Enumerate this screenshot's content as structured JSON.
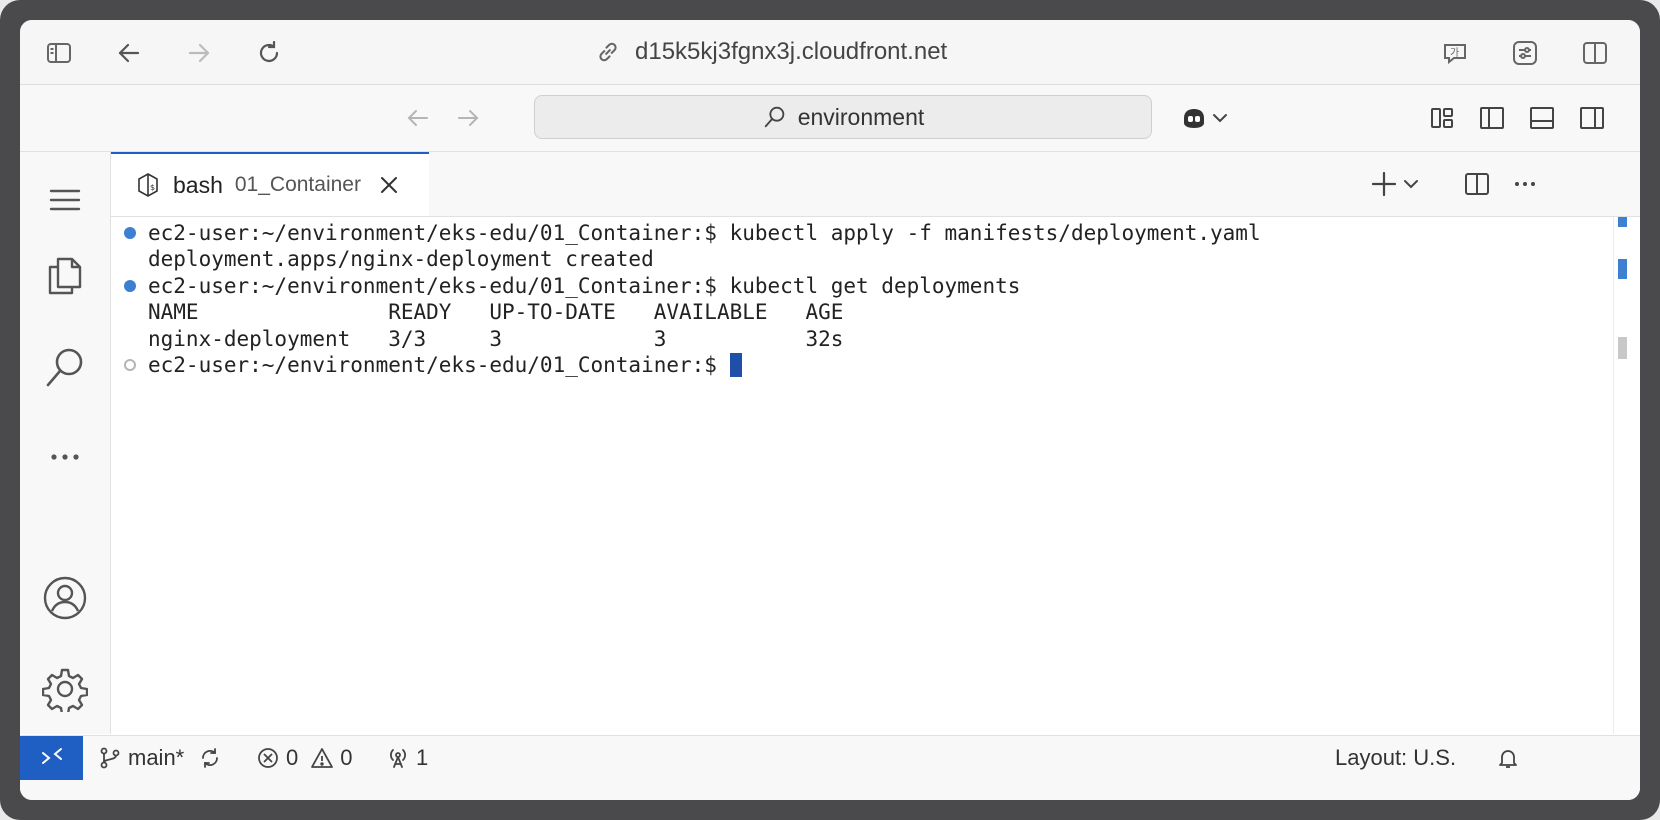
{
  "browser": {
    "url": "d15k5kj3fgnx3j.cloudfront.net",
    "icons": [
      "sidebar-icon",
      "back-icon",
      "forward-icon",
      "reload-icon",
      "link-icon",
      "translate-icon",
      "page-settings-icon",
      "split-view-icon"
    ]
  },
  "command_bar": {
    "search_text": "environment",
    "icons": [
      "back-arrow-icon",
      "forward-arrow-icon",
      "search-icon",
      "copilot-icon",
      "chevron-down-icon",
      "customize-layout-icon",
      "toggle-primary-sidebar-icon",
      "toggle-panel-icon",
      "toggle-secondary-sidebar-icon"
    ]
  },
  "activity_bar": {
    "items": [
      "menu-icon",
      "explorer-icon",
      "search-icon",
      "more-icon",
      "accounts-icon",
      "manage-gear-icon"
    ]
  },
  "tab": {
    "name": "bash",
    "description": "01_Container"
  },
  "terminal": {
    "lines": [
      {
        "decoration": "done",
        "text": "ec2-user:~/environment/eks-edu/01_Container:$ kubectl apply -f manifests/deployment.yaml"
      },
      {
        "decoration": "none",
        "text": "deployment.apps/nginx-deployment created"
      },
      {
        "decoration": "done",
        "text": "ec2-user:~/environment/eks-edu/01_Container:$ kubectl get deployments"
      },
      {
        "decoration": "none",
        "text": "NAME               READY   UP-TO-DATE   AVAILABLE   AGE"
      },
      {
        "decoration": "none",
        "text": "nginx-deployment   3/3     3            3           32s"
      },
      {
        "decoration": "pending",
        "text": "ec2-user:~/environment/eks-edu/01_Container:$ "
      }
    ]
  },
  "status_bar": {
    "branch": "main*",
    "errors": "0",
    "warnings": "0",
    "ports": "1",
    "layout": "Layout: U.S."
  },
  "colors": {
    "accent": "#1f5fc4",
    "terminal_decoration": "#3d7fd0"
  }
}
